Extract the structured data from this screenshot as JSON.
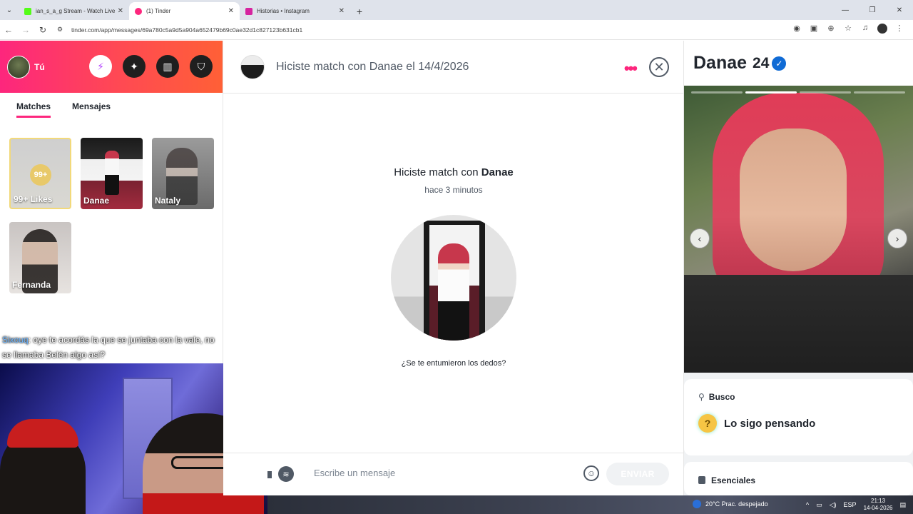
{
  "browser": {
    "tabs": [
      {
        "title": "ian_s_a_g Stream - Watch Live o",
        "favicon_color": "#53fc18",
        "active": false
      },
      {
        "title": "(1) Tinder",
        "favicon_color": "#fd267d",
        "active": true
      },
      {
        "title": "Historias • Instagram",
        "favicon_color": "#d6249f",
        "active": false
      }
    ],
    "url": "tinder.com/app/messages/69a780c5a9d5a904a652479b69c0ae32d1c827123b631cb1"
  },
  "sidebar": {
    "me_label": "Tú",
    "tabs": [
      "Matches",
      "Mensajes"
    ],
    "likes": {
      "badge": "99+",
      "label": "99+ Likes"
    },
    "matches": [
      {
        "name": "Danae"
      },
      {
        "name": "Nataly"
      },
      {
        "name": "Fernanda"
      }
    ]
  },
  "chat_overlay": {
    "user": "Sixouq",
    "text": ": oye te acordás la que se juntaba con la vale, no se llamaba Belén algo así?"
  },
  "conversation": {
    "header_text": "Hiciste match con Danae el 14/4/2026",
    "match_prefix": "Hiciste match con",
    "match_name": "Danae",
    "match_time": "hace 3 minutos",
    "prompt": "¿Se te entumieron los dedos?",
    "composer_placeholder": "Escribe un mensaje",
    "send_label": "ENVIAR"
  },
  "profile": {
    "name": "Danae",
    "age": "24",
    "photo_count": 4,
    "photo_active": 2,
    "busco_label": "Busco",
    "busco_value": "Lo sigo pensando",
    "esenciales_label": "Esenciales"
  },
  "taskbar": {
    "weather": "20°C  Prac. despejado",
    "lang": "ESP",
    "time": "21:13",
    "date": "14-04-2026"
  },
  "colors": {
    "tinder_gradient_start": "#fd267d",
    "tinder_gradient_end": "#ff6036",
    "verified": "#106bd5"
  }
}
